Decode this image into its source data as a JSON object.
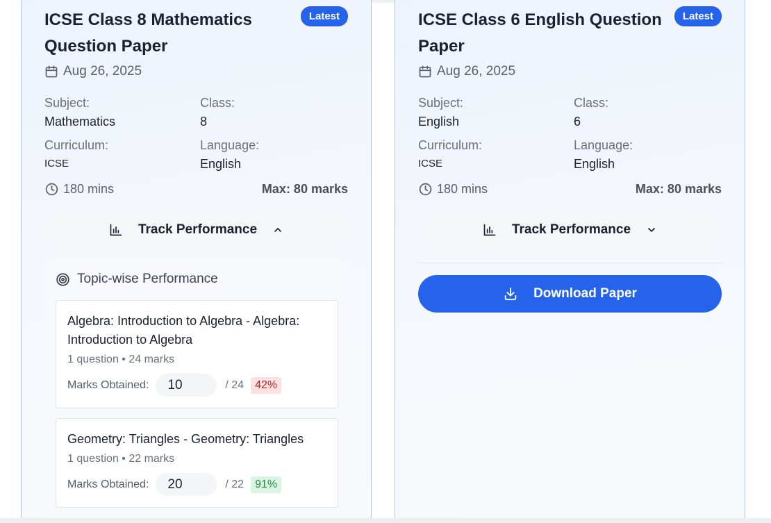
{
  "cards": [
    {
      "title": "ICSE Class 8 Mathematics Question Paper",
      "badge": "Latest",
      "date": "Aug 26, 2025",
      "subject_label": "Subject:",
      "subject": "Mathematics",
      "class_label": "Class:",
      "class": "8",
      "curriculum_label": "Curriculum:",
      "curriculum": "ICSE",
      "language_label": "Language:",
      "language": "English",
      "duration": "180 mins",
      "max_marks": "Max: 80 marks",
      "track_label": "Track Performance",
      "track_icon": "chevron-up-icon",
      "performance": {
        "heading": "Topic-wise Performance",
        "topics": [
          {
            "name": "Algebra: Introduction to Algebra - Algebra: Introduction to Algebra",
            "sub": "1 question • 24 marks",
            "marks_label": "Marks Obtained:",
            "obtained": "10",
            "total": "/ 24",
            "percent": "42%"
          },
          {
            "name": "Geometry: Triangles - Geometry: Triangles",
            "sub": "1 question • 22 marks",
            "marks_label": "Marks Obtained:",
            "obtained": "20",
            "total": "/ 22",
            "percent": "91%"
          }
        ]
      }
    },
    {
      "title": "ICSE Class 6 English Question Paper",
      "badge": "Latest",
      "date": "Aug 26, 2025",
      "subject_label": "Subject:",
      "subject": "English",
      "class_label": "Class:",
      "class": "6",
      "curriculum_label": "Curriculum:",
      "curriculum": "ICSE",
      "language_label": "Language:",
      "language": "English",
      "duration": "180 mins",
      "max_marks": "Max: 80 marks",
      "track_label": "Track Performance",
      "track_icon": "chevron-down-icon",
      "download_label": "Download Paper"
    }
  ],
  "colors": {
    "accent": "#2563eb",
    "card_border": "#a8c5e8",
    "pct_low_bg": "#fde0e0",
    "pct_high_bg": "#dcf5e3"
  }
}
